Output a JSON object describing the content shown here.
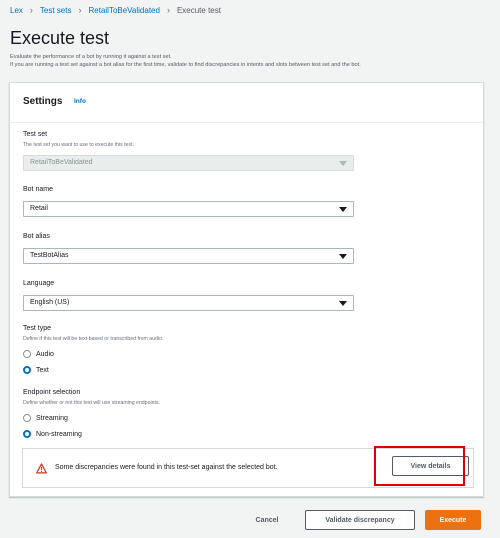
{
  "breadcrumb": {
    "items": [
      "Lex",
      "Test sets",
      "RetailToBeValidated"
    ],
    "current": "Execute test"
  },
  "page": {
    "title": "Execute test",
    "description_line1": "Evaluate the performance of a bot by running it against a test set.",
    "description_line2": "If you are running a test set against a bot alias for the first time, validate to find discrepancies in intents and slots between test set and the bot."
  },
  "settings": {
    "title": "Settings",
    "info_label": "Info",
    "test_set": {
      "label": "Test set",
      "help": "The test set you want to use to execute this test.",
      "value": "RetailToBeValidated"
    },
    "bot_name": {
      "label": "Bot name",
      "value": "Retail"
    },
    "bot_alias": {
      "label": "Bot alias",
      "value": "TestBotAlias"
    },
    "language": {
      "label": "Language",
      "value": "English (US)"
    },
    "test_type": {
      "label": "Test type",
      "help": "Define if this test will be text-based or transcribed from audio.",
      "options": [
        "Audio",
        "Text"
      ],
      "selected": "Text"
    },
    "endpoint": {
      "label": "Endpoint selection",
      "help": "Define whether or not this test will use streaming endpoints.",
      "options": [
        "Streaming",
        "Non-streaming"
      ],
      "selected": "Non-streaming"
    },
    "alert": {
      "message": "Some discrepancies were found in this test-set against the selected bot.",
      "button_label": "View details"
    }
  },
  "footer": {
    "cancel_label": "Cancel",
    "validate_label": "Validate discrepancy",
    "execute_label": "Execute"
  },
  "colors": {
    "link": "#0073bb",
    "primary_button": "#ec7211",
    "warning": "#d13212",
    "highlight": "#e00000"
  }
}
